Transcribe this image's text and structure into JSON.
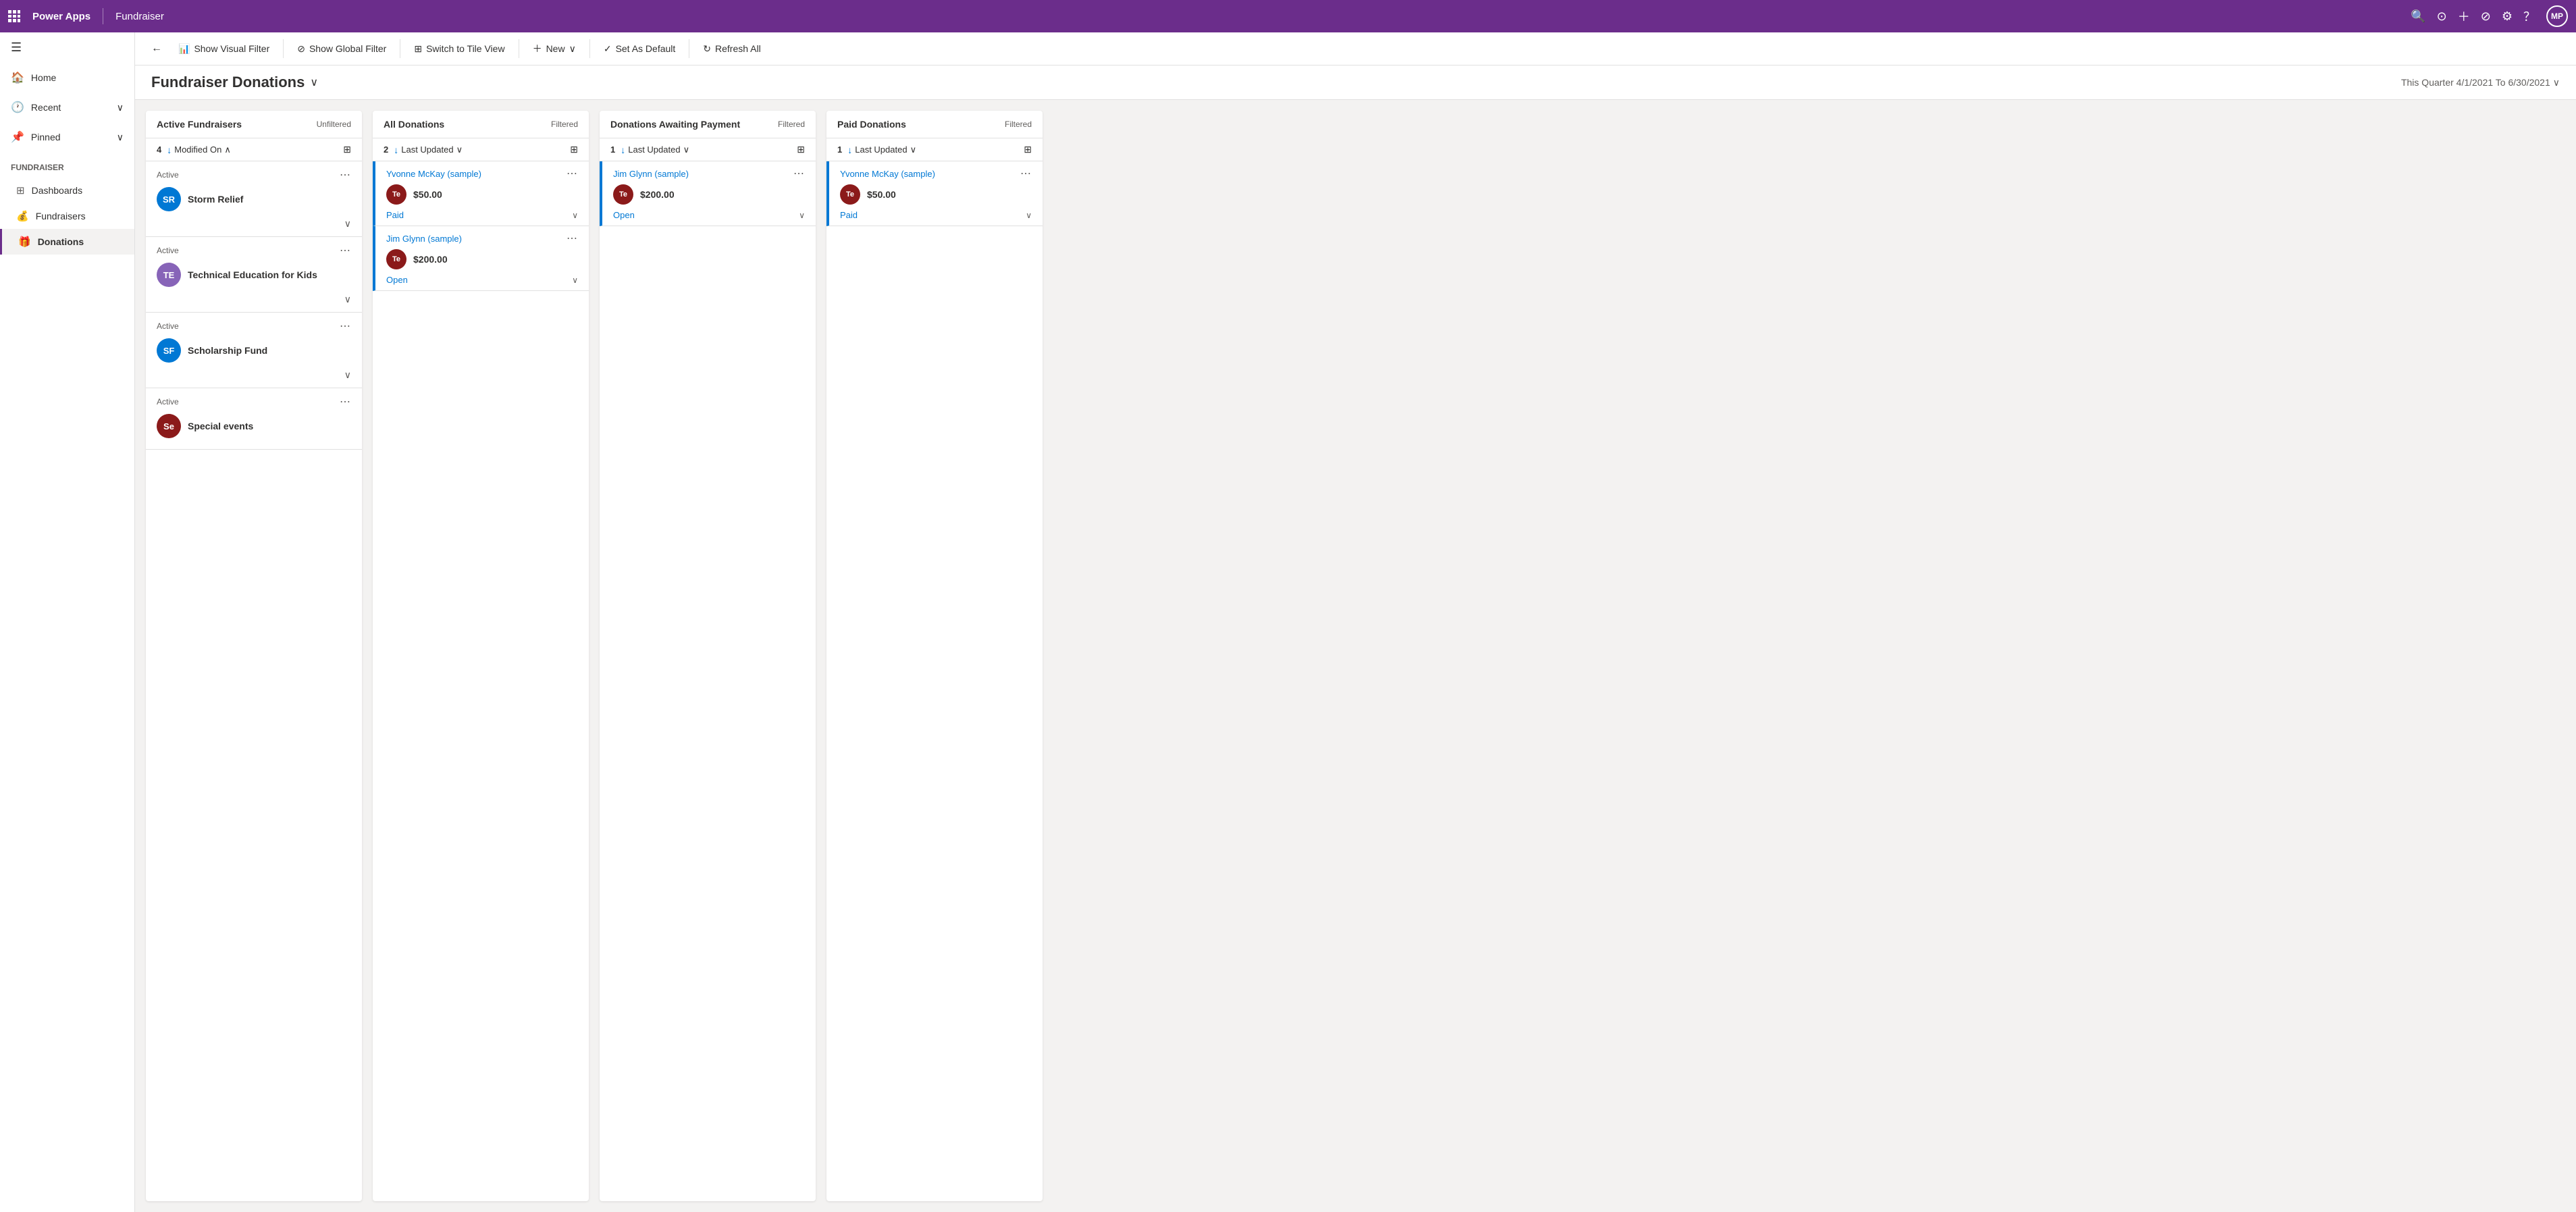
{
  "topNav": {
    "appName": "Power Apps",
    "pageName": "Fundraiser",
    "userInitials": "MP"
  },
  "sidebar": {
    "navItems": [
      {
        "id": "home",
        "label": "Home",
        "icon": "🏠"
      },
      {
        "id": "recent",
        "label": "Recent",
        "icon": "🕐",
        "hasChevron": true
      },
      {
        "id": "pinned",
        "label": "Pinned",
        "icon": "📌",
        "hasChevron": true
      }
    ],
    "sectionLabel": "Fundraiser",
    "subItems": [
      {
        "id": "dashboards",
        "label": "Dashboards",
        "icon": "📊"
      },
      {
        "id": "fundraisers",
        "label": "Fundraisers",
        "icon": "💰"
      },
      {
        "id": "donations",
        "label": "Donations",
        "icon": "🎁",
        "active": true
      }
    ]
  },
  "toolbar": {
    "showVisualFilter": "Show Visual Filter",
    "showGlobalFilter": "Show Global Filter",
    "switchToTileView": "Switch to Tile View",
    "new": "New",
    "setAsDefault": "Set As Default",
    "refreshAll": "Refresh All"
  },
  "pageHeader": {
    "title": "Fundraiser Donations",
    "dateFilter": "This Quarter 4/1/2021 To 6/30/2021"
  },
  "columns": [
    {
      "id": "active-fundraisers",
      "title": "Active Fundraisers",
      "filterLabel": "Unfiltered",
      "count": 4,
      "sortLabel": "Modified On",
      "cards": [
        {
          "status": "Active",
          "name": "Storm Relief",
          "avatarInitials": "SR",
          "avatarColor": "#0078d4"
        },
        {
          "status": "Active",
          "name": "Technical Education for Kids",
          "avatarInitials": "TE",
          "avatarColor": "#8764b8"
        },
        {
          "status": "Active",
          "name": "Scholarship Fund",
          "avatarInitials": "SF",
          "avatarColor": "#0078d4"
        },
        {
          "status": "Active",
          "name": "Special events",
          "avatarInitials": "Se",
          "avatarColor": "#8b1a1a"
        }
      ]
    },
    {
      "id": "all-donations",
      "title": "All Donations",
      "filterLabel": "Filtered",
      "count": 2,
      "sortLabel": "Last Updated",
      "donations": [
        {
          "person": "Yvonne McKay (sample)",
          "avatarInitials": "Te",
          "avatarColor": "#8b1a1a",
          "amount": "$50.00",
          "status": "Paid"
        },
        {
          "person": "Jim Glynn (sample)",
          "avatarInitials": "Te",
          "avatarColor": "#8b1a1a",
          "amount": "$200.00",
          "status": "Open"
        }
      ]
    },
    {
      "id": "donations-awaiting-payment",
      "title": "Donations Awaiting Payment",
      "filterLabel": "Filtered",
      "count": 1,
      "sortLabel": "Last Updated",
      "donations": [
        {
          "person": "Jim Glynn (sample)",
          "avatarInitials": "Te",
          "avatarColor": "#8b1a1a",
          "amount": "$200.00",
          "status": "Open"
        }
      ]
    },
    {
      "id": "paid-donations",
      "title": "Paid Donations",
      "filterLabel": "Filtered",
      "count": 1,
      "sortLabel": "Last Updated",
      "donations": [
        {
          "person": "Yvonne McKay (sample)",
          "avatarInitials": "Te",
          "avatarColor": "#8b1a1a",
          "amount": "$50.00",
          "status": "Paid"
        }
      ]
    }
  ]
}
